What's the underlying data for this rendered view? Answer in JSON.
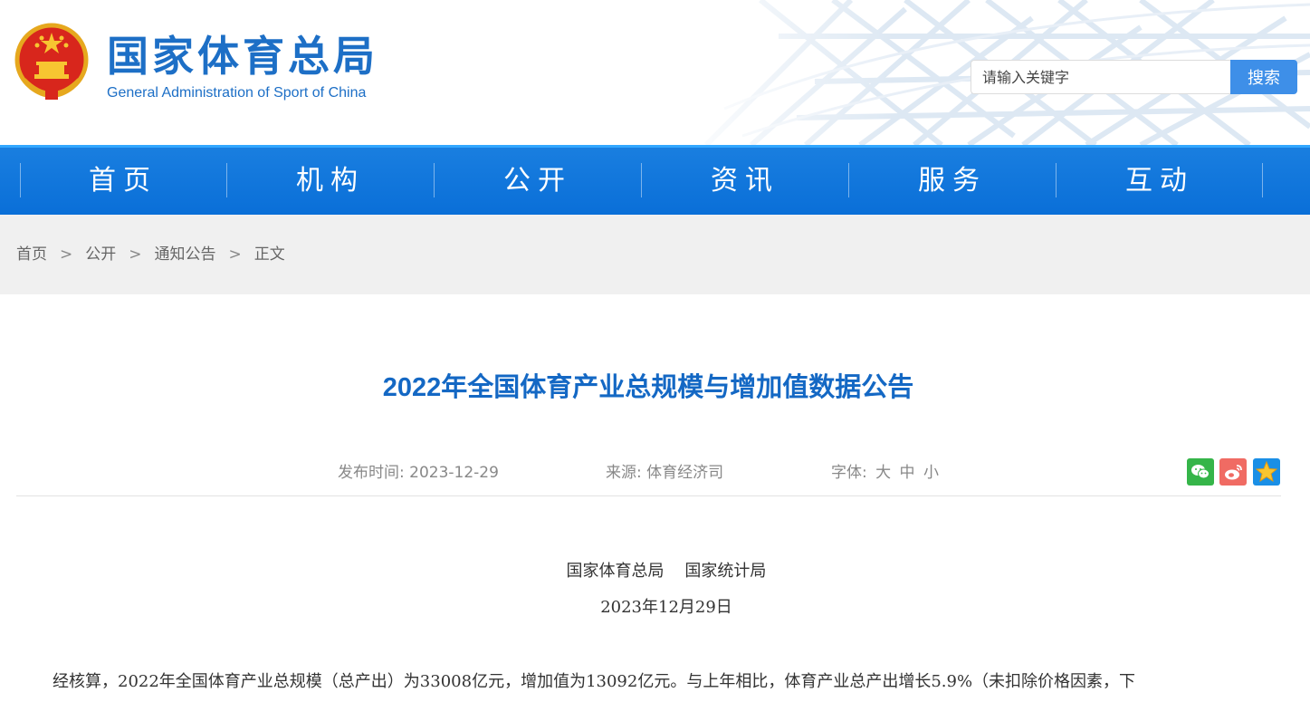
{
  "header": {
    "site_title": "国家体育总局",
    "site_subtitle": "General Administration of Sport of China",
    "emblem_icon": "national-emblem-icon",
    "search": {
      "placeholder": "请输入关键字",
      "button_label": "搜索"
    }
  },
  "nav": {
    "items": [
      {
        "label": "首页"
      },
      {
        "label": "机构"
      },
      {
        "label": "公开"
      },
      {
        "label": "资讯"
      },
      {
        "label": "服务"
      },
      {
        "label": "互动"
      }
    ]
  },
  "breadcrumb": {
    "items": [
      "首页",
      "公开",
      "通知公告"
    ],
    "separator": ">",
    "current": "正文"
  },
  "article": {
    "title": "2022年全国体育产业总规模与增加值数据公告",
    "publish_label": "发布时间:",
    "publish_date": "2023-12-29",
    "source_label": "来源:",
    "source": "体育经济司",
    "font_label": "字体:",
    "font_sizes": [
      "大",
      "中",
      "小"
    ],
    "share_icons": [
      "wechat-icon",
      "weibo-icon",
      "favorite-star-icon"
    ],
    "issuers": "国家体育总局    国家统计局",
    "issue_date": "2023年12月29日",
    "body_first_line": "经核算，2022年全国体育产业总规模（总产出）为33008亿元，增加值为13092亿元。与上年相比，体育产业总产出增长5.9%（未扣除价格因素，下"
  },
  "colors": {
    "brand_blue": "#1d6fc6",
    "nav_blue": "#0a6fd8",
    "title_blue": "#1468c4",
    "search_button": "#3e8fe8",
    "breadcrumb_bg": "#f0f0f0"
  }
}
